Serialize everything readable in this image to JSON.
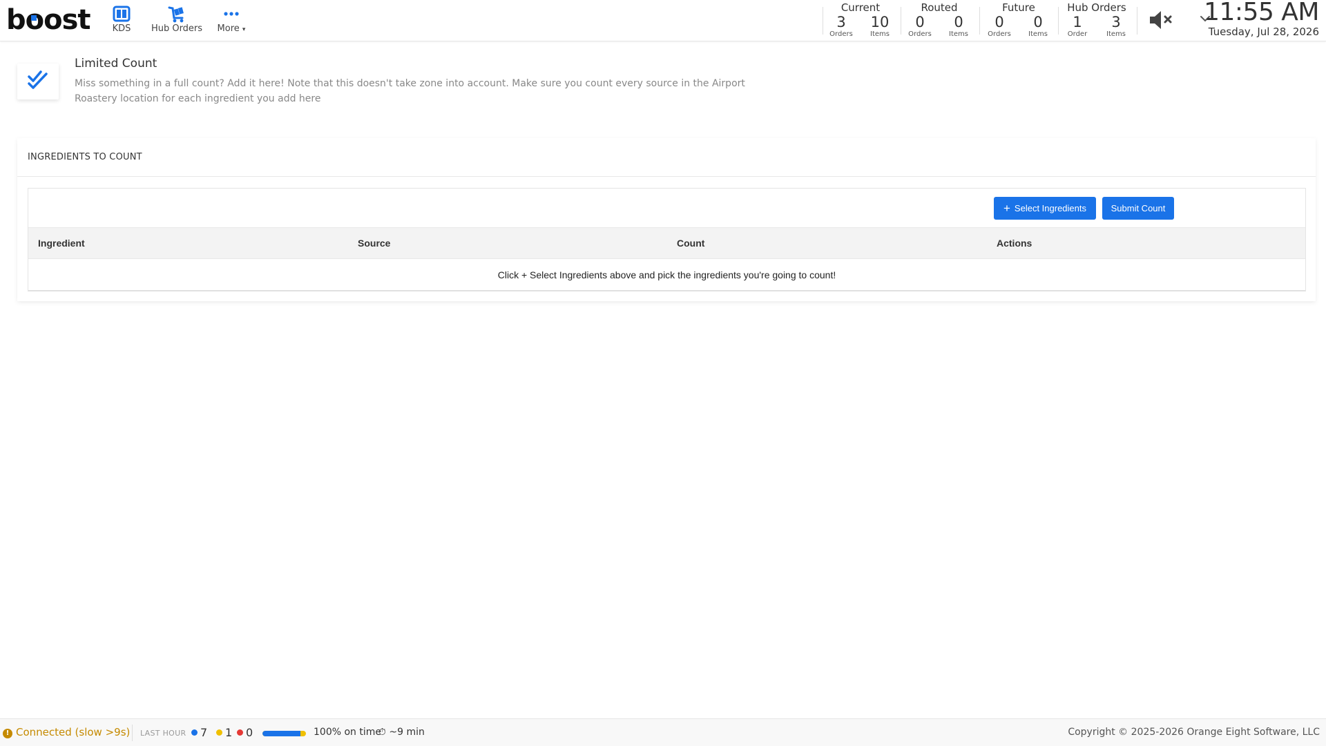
{
  "brand": {
    "logo_text_b": "b",
    "logo_text_o1": "o",
    "logo_text_rest": "ost"
  },
  "nav": {
    "kds_label": "KDS",
    "hub_orders_label": "Hub Orders",
    "more_label": "More"
  },
  "stats": [
    {
      "title": "Current",
      "orders": "3",
      "orders_unit": "Orders",
      "items": "10",
      "items_unit": "Items"
    },
    {
      "title": "Routed",
      "orders": "0",
      "orders_unit": "Orders",
      "items": "0",
      "items_unit": "Items"
    },
    {
      "title": "Future",
      "orders": "0",
      "orders_unit": "Orders",
      "items": "0",
      "items_unit": "Items"
    },
    {
      "title": "Hub Orders",
      "orders": "1",
      "orders_unit": "Order",
      "items": "3",
      "items_unit": "Items"
    }
  ],
  "clock": {
    "time": "11:55 AM",
    "date": "Tuesday, Jul 28, 2026"
  },
  "header": {
    "title": "Limited Count",
    "description": "Miss something in a full count? Add it here! Note that this doesn't take zone into account. Make sure you count every source in the Airport Roastery location for each ingredient you add here"
  },
  "card": {
    "title": "INGREDIENTS TO COUNT",
    "select_button": "Select Ingredients",
    "submit_button": "Submit Count",
    "columns": [
      "Ingredient",
      "Source",
      "Count",
      "Actions"
    ],
    "empty_message": "Click + Select Ingredients above and pick the ingredients you're going to count!"
  },
  "footer": {
    "connection": "Connected (slow >9s)",
    "last_hour_label": "LAST HOUR",
    "blue_count": "7",
    "yellow_count": "1",
    "red_count": "0",
    "on_time_fraction": 0.88,
    "on_time_text": "100% on time",
    "timer_text": "~9 min",
    "copyright": "Copyright © 2025-2026 Orange Eight Software, LLC"
  },
  "colors": {
    "accent": "#1a73e8",
    "warning": "#c58a00",
    "yellow": "#f0c000",
    "red": "#e53935"
  },
  "icons": {
    "kds": "kds-grid-icon",
    "hub": "hub-cart-icon",
    "more": "more-dots-icon",
    "mute": "speaker-muted-icon",
    "chevron": "chevron-down-icon",
    "header": "double-check-icon",
    "timer": "stopwatch-icon",
    "connection": "warning-circle-icon"
  }
}
